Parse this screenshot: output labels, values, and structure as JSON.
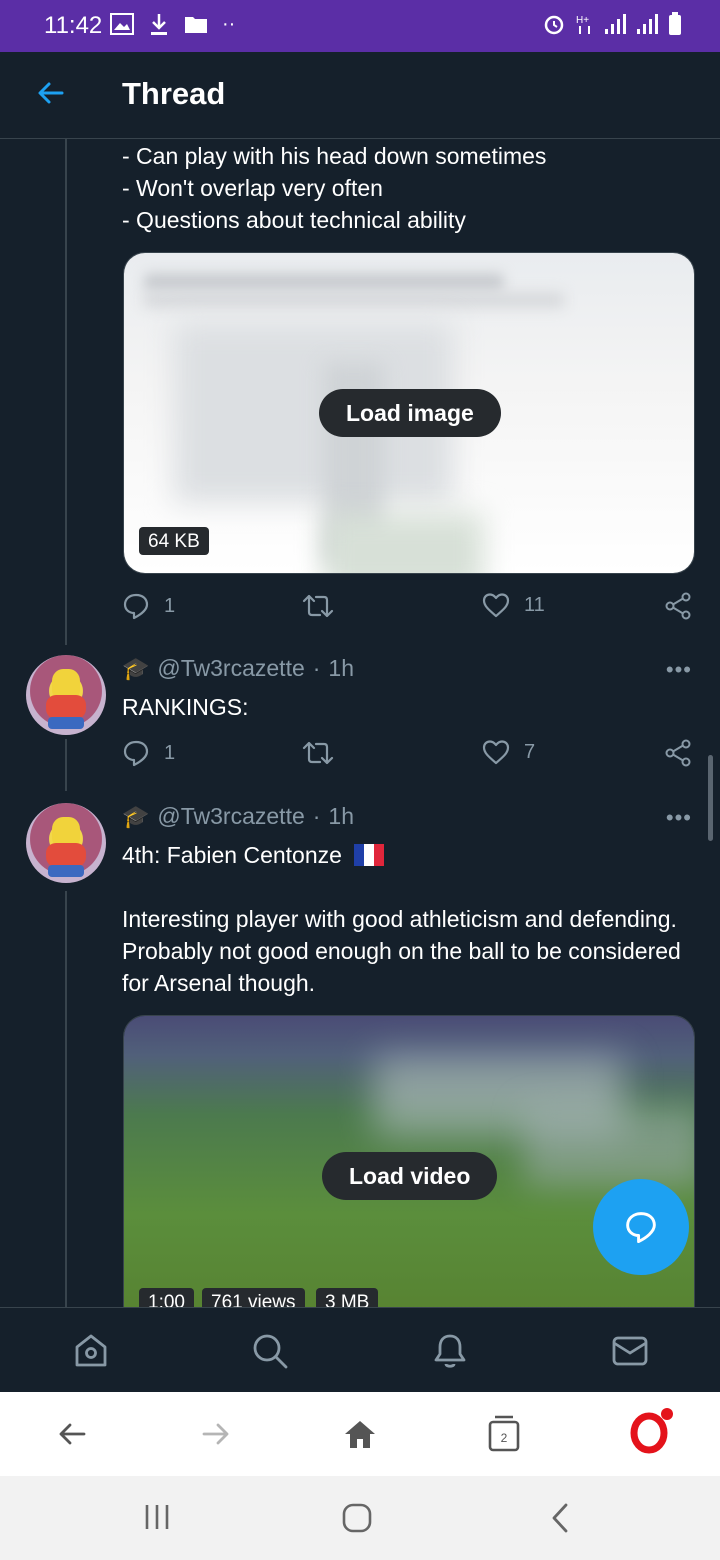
{
  "status_bar": {
    "time": "11:42"
  },
  "header": {
    "title": "Thread"
  },
  "tweet1": {
    "lines": [
      "- Can play with his head down sometimes",
      "- Won't overlap very often",
      "- Questions about technical ability"
    ],
    "media": {
      "button": "Load image",
      "size": "64 KB"
    },
    "replies": "1",
    "likes": "11"
  },
  "tweet2": {
    "handle": "@Tw3rcazette",
    "time": "1h",
    "text": "RANKINGS:",
    "replies": "1",
    "likes": "7"
  },
  "tweet3": {
    "handle": "@Tw3rcazette",
    "time": "1h",
    "headline": "4th: Fabien Centonze",
    "flag": "🇫🇷",
    "body": "Interesting player with good athleticism and defending. Probably not good enough on the ball to be considered for Arsenal though.",
    "media": {
      "button": "Load video",
      "duration": "1:00",
      "views": "761 views",
      "size": "3 MB"
    }
  },
  "browser": {
    "tab_count": "2"
  },
  "colors": {
    "accent": "#1da1f2",
    "status_bar": "#5b2ea6",
    "background": "#15202b",
    "opera_red": "#e4131b"
  }
}
